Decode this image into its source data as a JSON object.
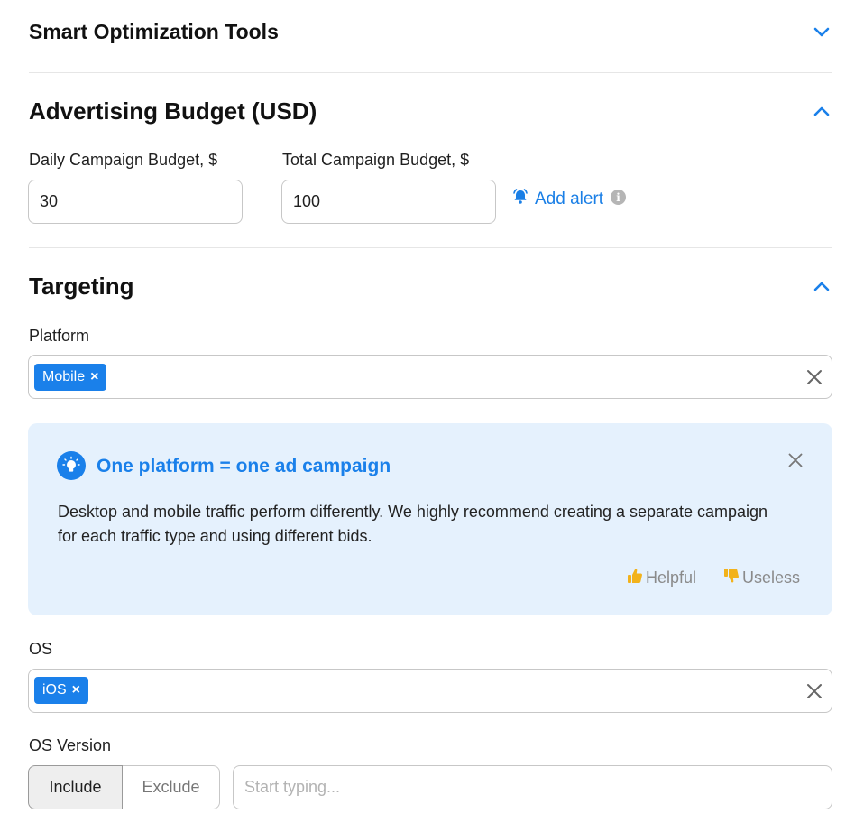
{
  "sections": {
    "smart": {
      "title": "Smart Optimization Tools"
    },
    "budget": {
      "title": "Advertising Budget (USD)",
      "daily_label": "Daily Campaign Budget, $",
      "daily_value": "30",
      "total_label": "Total Campaign Budget, $",
      "total_value": "100",
      "add_alert_label": "Add alert"
    },
    "targeting": {
      "title": "Targeting",
      "platform_label": "Platform",
      "platform_chip": "Mobile",
      "tip": {
        "title": "One platform = one ad campaign",
        "body": "Desktop and mobile traffic perform differently. We highly recommend creating a separate campaign for each traffic type and using different bids.",
        "helpful": "Helpful",
        "useless": "Useless"
      },
      "os_label": "OS",
      "os_chip": "iOS",
      "os_version_label": "OS Version",
      "include_label": "Include",
      "exclude_label": "Exclude",
      "os_version_placeholder": "Start typing..."
    }
  },
  "colors": {
    "accent": "#1a80ea",
    "tip_background": "#e5f1fd"
  },
  "icons": [
    "chevron-down-icon",
    "chevron-up-icon",
    "bell-icon",
    "info-icon",
    "close-icon",
    "lightbulb-icon",
    "thumbs-up-icon",
    "thumbs-down-icon"
  ]
}
